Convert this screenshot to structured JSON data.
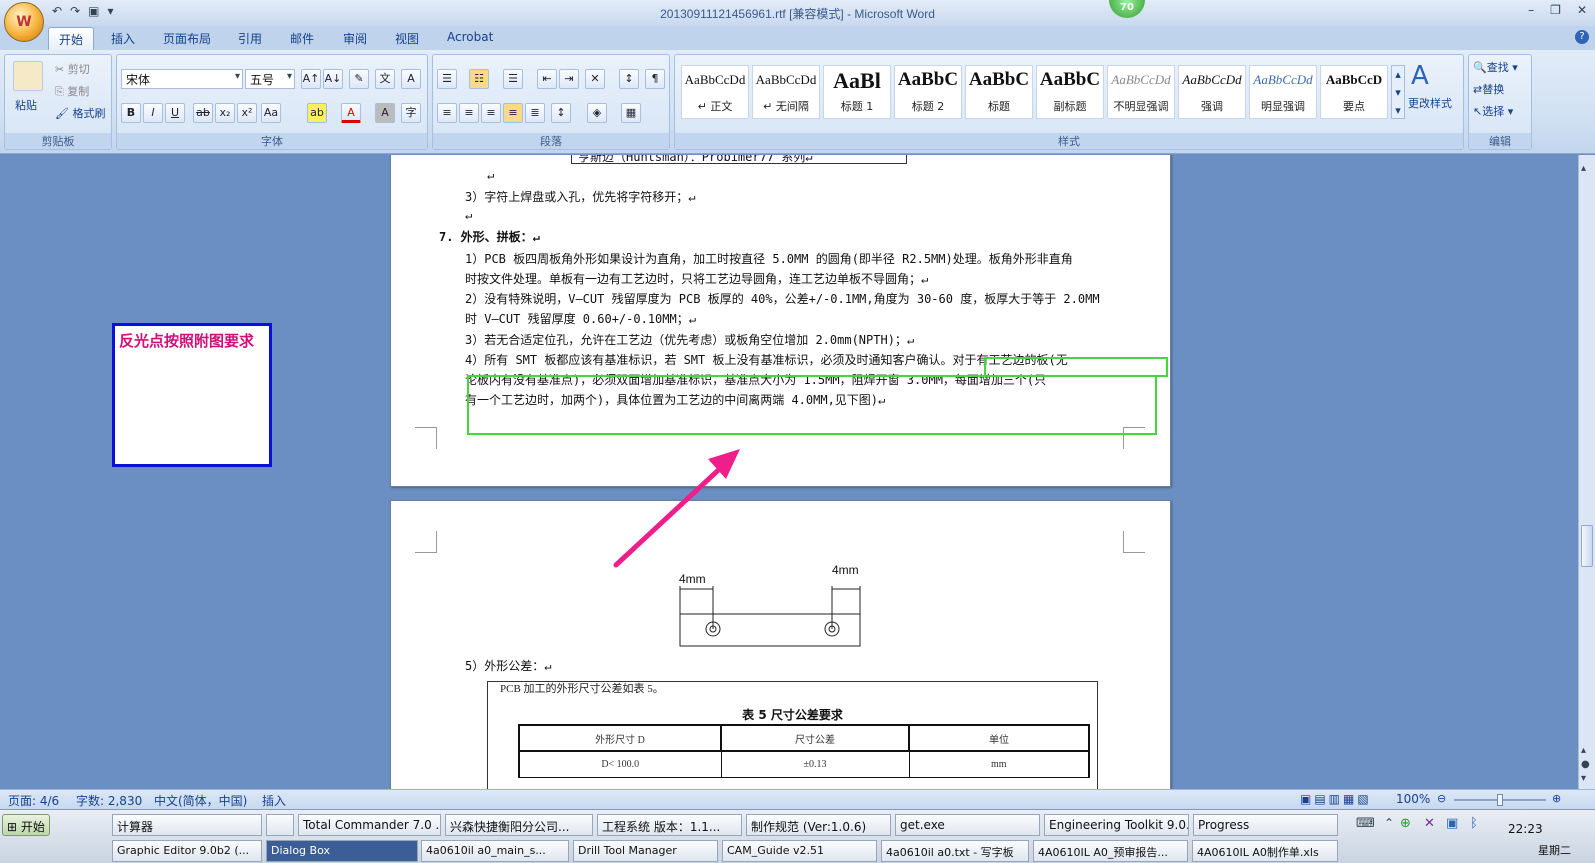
{
  "window": {
    "title": "20130911121456961.rtf [兼容模式] - Microsoft Word",
    "badge": "70",
    "office_button": "W"
  },
  "tabs": [
    "开始",
    "插入",
    "页面布局",
    "引用",
    "邮件",
    "审阅",
    "视图",
    "Acrobat"
  ],
  "ribbon": {
    "clipboard": {
      "label": "剪贴板",
      "paste": "粘贴",
      "cut": "剪切",
      "copy": "复制",
      "format_painter": "格式刷"
    },
    "font": {
      "label": "字体",
      "font_name": "宋体",
      "font_size": "五号"
    },
    "paragraph": {
      "label": "段落"
    },
    "styles": {
      "label": "样式",
      "items": [
        {
          "sample": "AaBbCcDd",
          "name": "↵ 正文"
        },
        {
          "sample": "AaBbCcDd",
          "name": "↵ 无间隔"
        },
        {
          "sample": "AaBl",
          "name": "标题 1"
        },
        {
          "sample": "AaBbC",
          "name": "标题 2"
        },
        {
          "sample": "AaBbC",
          "name": "标题"
        },
        {
          "sample": "AaBbC",
          "name": "副标题"
        },
        {
          "sample": "AaBbCcDd",
          "name": "不明显强调"
        },
        {
          "sample": "AaBbCcDd",
          "name": "强调"
        },
        {
          "sample": "AaBbCcDd",
          "name": "明显强调"
        },
        {
          "sample": "AaBbCcD",
          "name": "要点"
        }
      ],
      "change_styles": "更改样式"
    },
    "editing": {
      "label": "编辑",
      "find": "查找",
      "replace": "替换",
      "select": "选择"
    }
  },
  "document": {
    "page1_lines": [
      "亨斯迈（Huntsman）：Probimer77 系列↵",
      "↵",
      "3）字符上焊盘或入孔，优先将字符移开；↵",
      "↵",
      "7.   外形、拼板：↵",
      "1）PCB 板四周板角外形如果设计为直角，加工时按直径 5.0MM 的圆角(即半径 R2.5MM)处理。板角外形非直角",
      "   时按文件处理。单板有一边有工艺边时，只将工艺边导圆角，连工艺边单板不导圆角；↵",
      "2）没有特殊说明，V—CUT 残留厚度为 PCB 板厚的 40%，公差+/-0.1MM,角度为 30-60 度，板厚大于等于 2.0MM",
      "   时 V—CUT 残留厚度 0.60+/-0.10MM；↵",
      "3）若无合适定位孔，允许在工艺边（优先考虑）或板角空位增加 2.0mm(NPTH)；↵",
      "4）所有 SMT 板都应该有基准标识，若 SMT 板上没有基准标识，必须及时通知客户确认。对于有工艺边的板(无",
      "   论板内有没有基准点)，必须双面增加基准标识，基准点大小为 1.5MM，阻焊开窗 3.0MM，每面增加三个(只",
      "   有一个工艺边时，加两个)，具体位置为工艺边的中间离两端 4.0MM,见下图)↵"
    ],
    "dim_left": "4mm",
    "dim_right": "4mm",
    "section5": "5）外形公差：↵",
    "table_intro": "PCB 加工的外形尺寸公差如表 5。",
    "table_title": "表 5   尺寸公差要求",
    "table_headers": [
      "外形尺寸 D",
      "尺寸公差",
      "单位"
    ],
    "table_rows": [
      [
        "D< 100.0",
        "±0.13",
        "mm"
      ]
    ]
  },
  "callout": {
    "text": "反光点按照附图要求",
    "border_color": "#0a10d8",
    "text_color": "#d0107a"
  },
  "status": {
    "page": "页面: 4/6",
    "words": "字数: 2,830",
    "language": "中文(简体，中国)",
    "mode": "插入",
    "zoom": "100%"
  },
  "taskbar": {
    "start": "开始",
    "row1": [
      "计算器",
      "",
      "Total Commander 7.0 ...",
      "兴森快捷衡阳分公司...",
      "工程系统  版本：1.1...",
      "制作规范 (Ver:1.0.6)",
      "get.exe",
      "Engineering Toolkit 9.0...",
      "Progress"
    ],
    "row2": [
      "Graphic Editor 9.0b2 (...",
      "Dialog Box",
      "4a0610il a0_main_s...",
      "Drill Tool Manager",
      "CAM_Guide v2.51",
      "4a0610il a0.txt - 写字板",
      "4A0610IL A0_预审报告...",
      "4A0610IL A0制作单.xls"
    ],
    "clock": "22:23",
    "day": "星期二"
  }
}
